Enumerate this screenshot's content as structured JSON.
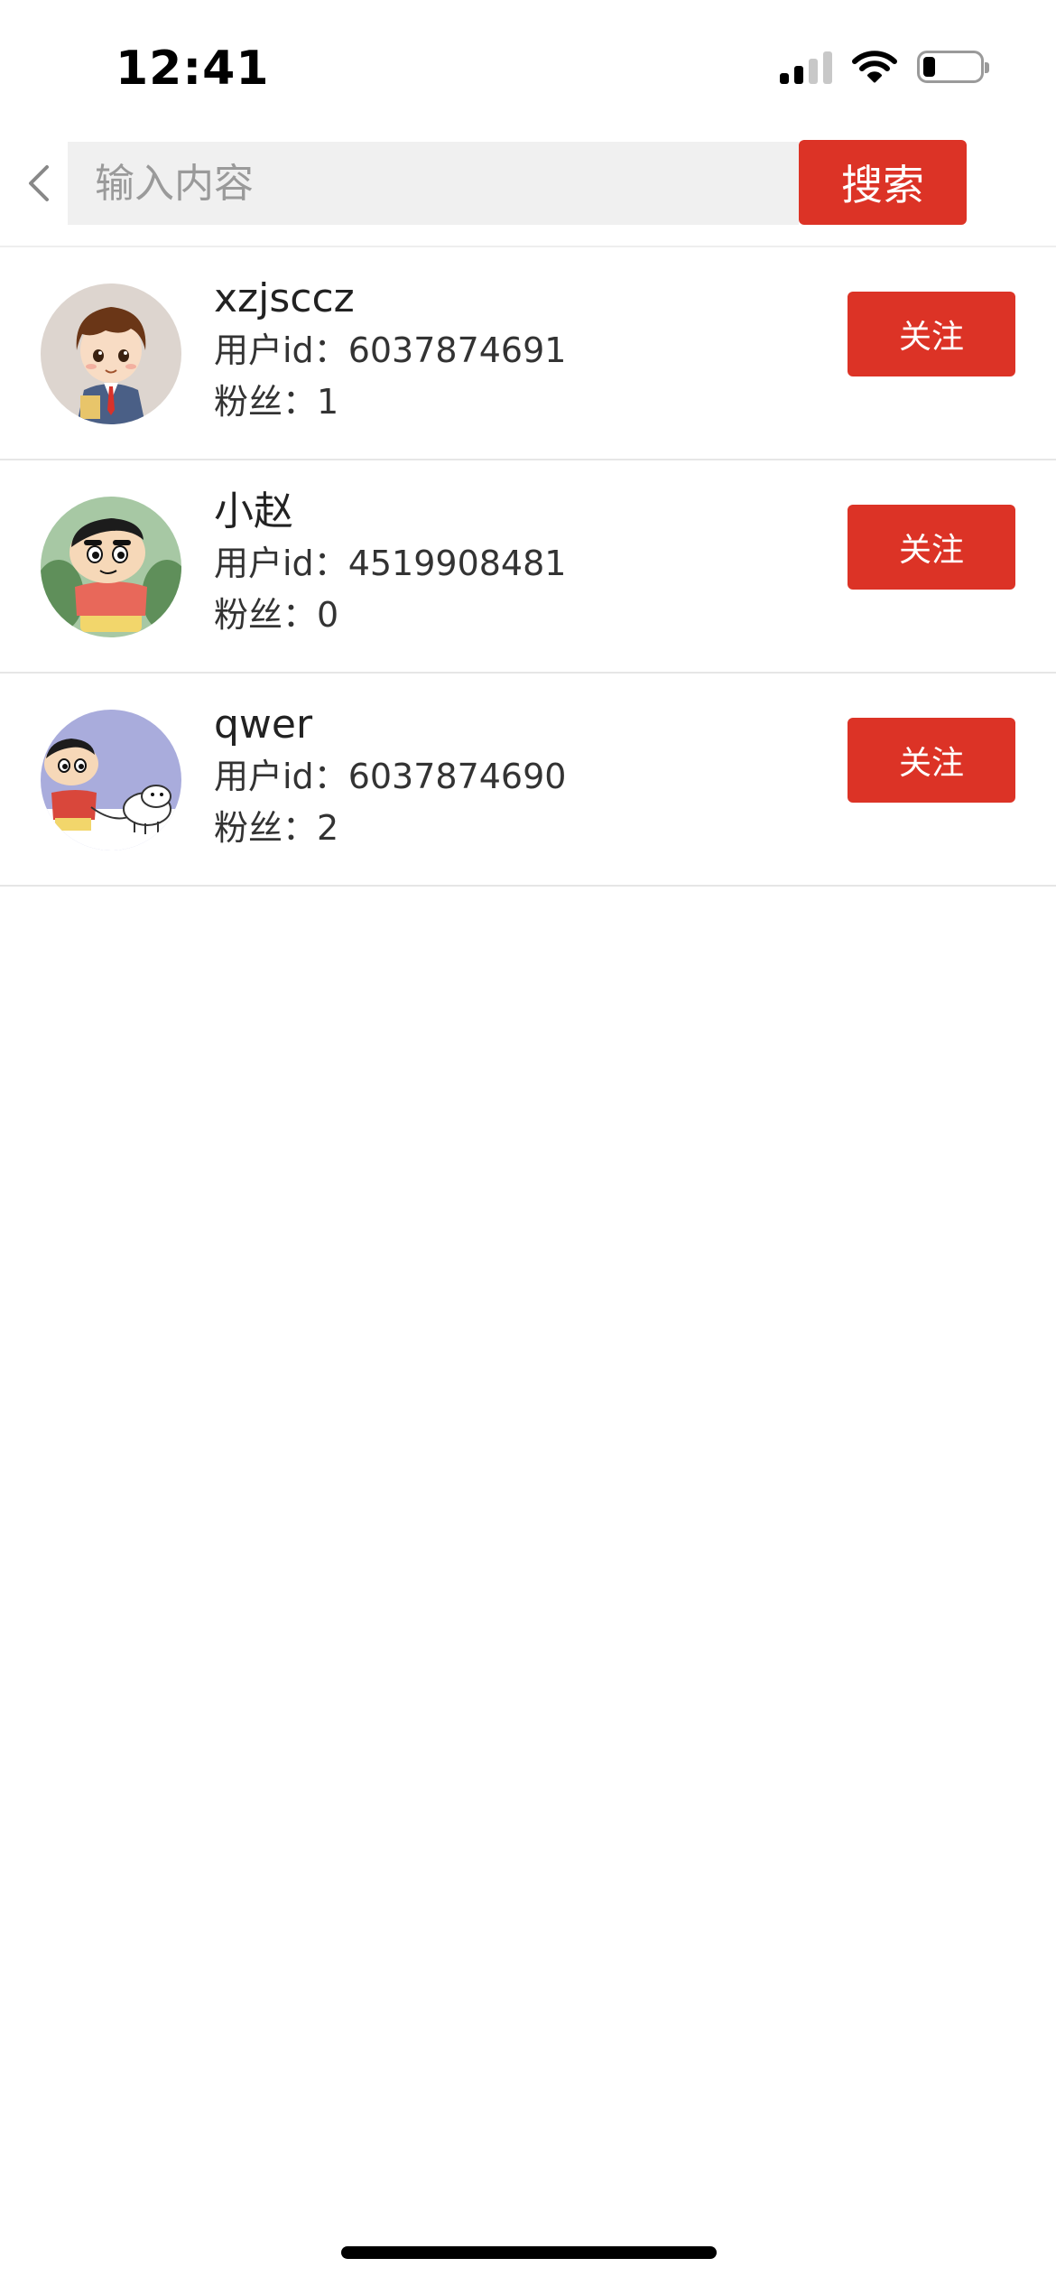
{
  "status_bar": {
    "time": "12:41",
    "icons": [
      "cellular-signal-icon",
      "wifi-icon",
      "battery-icon"
    ]
  },
  "search": {
    "back_icon": "chevron-left-icon",
    "placeholder": "输入内容",
    "value": "",
    "button_label": "搜索"
  },
  "users": [
    {
      "name": "xzjsccz",
      "id_label": "用户id：",
      "id": "6037874691",
      "fans_label": "粉丝：",
      "fans": "1",
      "follow_label": "关注",
      "avatar": "cartoon-boy-avatar"
    },
    {
      "name": "小赵",
      "id_label": "用户id：",
      "id": "4519908481",
      "fans_label": "粉丝：",
      "fans": "0",
      "follow_label": "关注",
      "avatar": "crayon-shinchan-avatar"
    },
    {
      "name": "qwer",
      "id_label": "用户id：",
      "id": "6037874690",
      "fans_label": "粉丝：",
      "fans": "2",
      "follow_label": "关注",
      "avatar": "shinchan-with-dog-avatar"
    }
  ],
  "colors": {
    "accent": "#dc3326",
    "input_background": "#f0f0f0",
    "divider": "#e6e6e6"
  }
}
